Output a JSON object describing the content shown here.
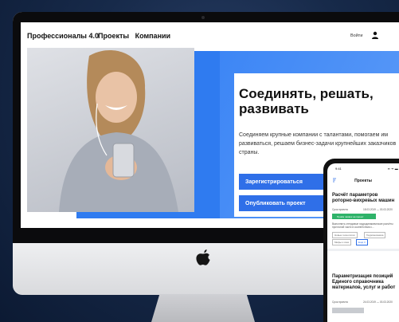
{
  "site": {
    "logo": "Профессионалы 4.0",
    "nav": [
      "Проекты",
      "Компании"
    ],
    "login": "Войти",
    "headline": "Соединять, решать, развивать",
    "subtext": "Соединяем крупные компании с талантами, помогаем им развиваться, решаем бизнес-задачи крупнейших заказчиков страны.",
    "register_button": "Зарегистрироваться",
    "publish_button": "Опубликовать проект"
  },
  "phone": {
    "status_time": "9:41",
    "status_right": "▪▪ ᯤ ▬",
    "title": "Проекты",
    "project1": {
      "title": "Расчёт параметров роторно-вихревых машин",
      "deadline_label": "Срок проекта",
      "deadline_value": "18.03.2019 — 03.03.2020",
      "status": "Приём заявок на проект",
      "desc": "Выполнить стендовые гидродинамические расчёты проточной части в соответствии с...",
      "tag1": "Новые технологии",
      "tag2": "Гидромеханика",
      "tag3": "Мифы и сказ",
      "tag4": "Ещё 3"
    },
    "project2": {
      "title": "Параметризация позиций Единого справочника материалов, услуг и работ",
      "deadline_label": "Срок проекта",
      "deadline_value": "24.03.2019 — 03.03.2020"
    }
  },
  "colors": {
    "accent_blue": "#2f7bf0",
    "button_blue": "#2f6fe8",
    "status_green": "#2fb36a"
  }
}
